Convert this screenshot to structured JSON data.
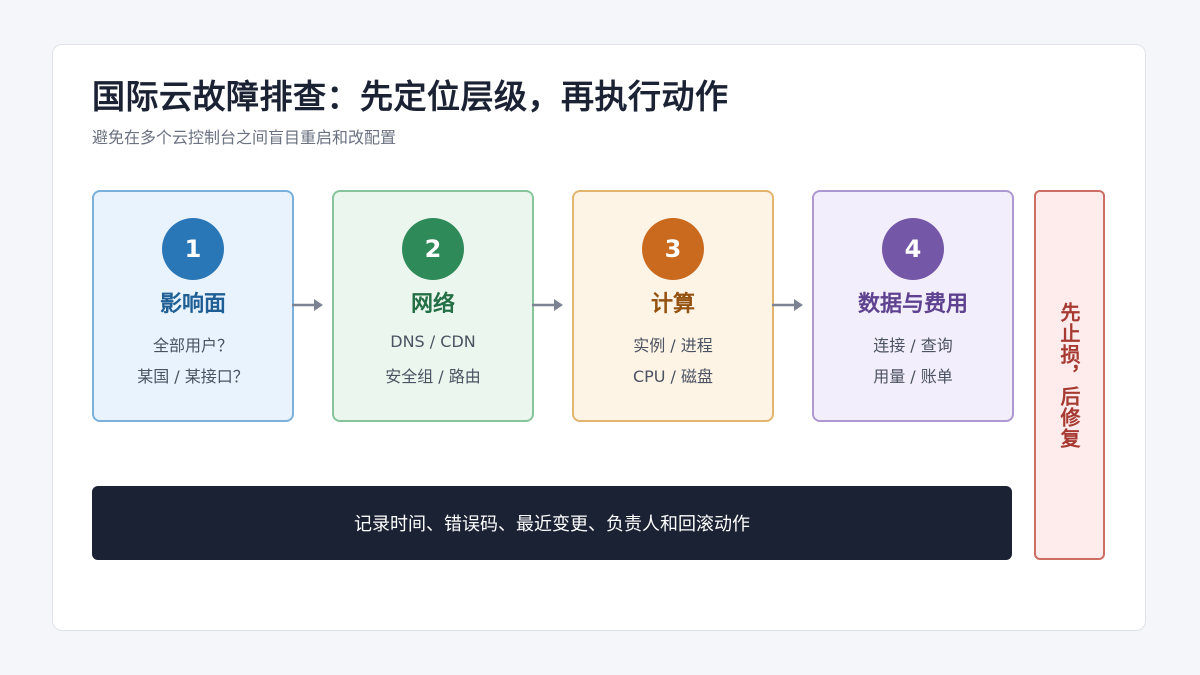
{
  "title": "国际云故障排查：先定位层级，再执行动作",
  "subtitle": "避免在多个云控制台之间盲目重启和改配置",
  "steps": [
    {
      "number": "1",
      "name": "影响面",
      "line1": "全部用户？",
      "line2": "某国 / 某接口？",
      "color": "#2a77b8",
      "name_color": "#1f5f95",
      "bg": "#e8f3fd",
      "border": "#7ab0dc"
    },
    {
      "number": "2",
      "name": "网络",
      "line1": "DNS / CDN",
      "line2": "安全组 / 路由",
      "color": "#2e8a58",
      "name_color": "#256f46",
      "bg": "#ebf7ee",
      "border": "#86c59b"
    },
    {
      "number": "3",
      "name": "计算",
      "line1": "实例 / 进程",
      "line2": "CPU / 磁盘",
      "color": "#c96a1e",
      "name_color": "#94510f",
      "bg": "#fdf4e6",
      "border": "#e2b46e"
    },
    {
      "number": "4",
      "name": "数据与费用",
      "line1": "连接 / 查询",
      "line2": "用量 / 账单",
      "color": "#7557a8",
      "name_color": "#5e4290",
      "bg": "#f3eefb",
      "border": "#ad98d2"
    }
  ],
  "side_note": "先止损，后修复",
  "footer": "记录时间、错误码、最近变更、负责人和回滚动作",
  "colors": {
    "arrow": "#7c8494",
    "side_bg": "#fdeceb",
    "side_border": "#cc6e64",
    "footer_bg": "#1b2234"
  }
}
